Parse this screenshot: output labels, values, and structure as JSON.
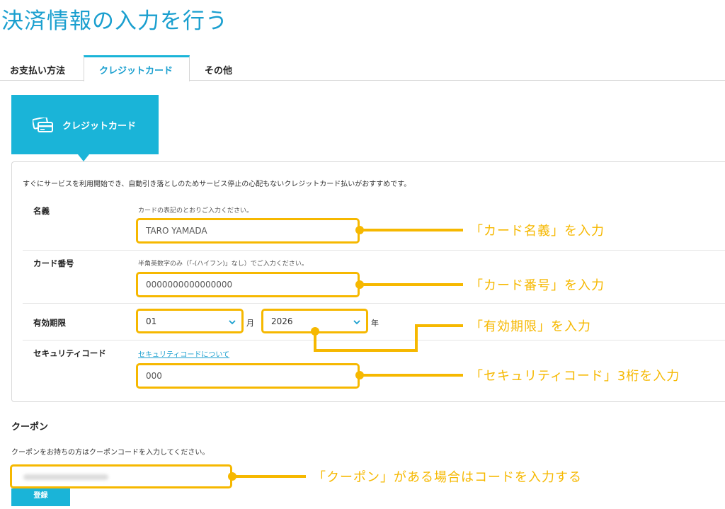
{
  "page": {
    "title": "決済情報の入力を行う"
  },
  "tabs": [
    {
      "label": "お支払い方法"
    },
    {
      "label": "クレジットカード"
    },
    {
      "label": "その他"
    }
  ],
  "method_card": {
    "label": "クレジットカード",
    "icon": "credit-card-icon"
  },
  "form": {
    "intro": "すぐにサービスを利用開始でき、自動引き落としのためサービス停止の心配もないクレジットカード払いがおすすめです。",
    "name": {
      "label": "名義",
      "hint": "カードの表記のとおりご入力ください。",
      "value": "TARO YAMADA"
    },
    "card_number": {
      "label": "カード番号",
      "hint": "半角英数字のみ（「-(ハイフン)」なし）でご入力ください。",
      "value": "0000000000000000"
    },
    "expiry": {
      "label": "有効期限",
      "month": "01",
      "month_unit": "月",
      "year": "2026",
      "year_unit": "年"
    },
    "security": {
      "label": "セキュリティコード",
      "link": "セキュリティコードについて",
      "value": "000"
    }
  },
  "annotations": {
    "name": "「カード名義」を入力",
    "card_number": "「カード番号」を入力",
    "expiry": "「有効期限」を入力",
    "security": "「セキュリティコード」3桁を入力",
    "coupon": "「クーポン」がある場合はコードを入力する"
  },
  "coupon": {
    "title": "クーポン",
    "description": "クーポンをお持ちの方はクーポンコードを入力してください。",
    "button": "登録"
  },
  "colors": {
    "accent": "#1ab4d8",
    "highlight": "#f6b800",
    "link": "#1a9fcf"
  }
}
